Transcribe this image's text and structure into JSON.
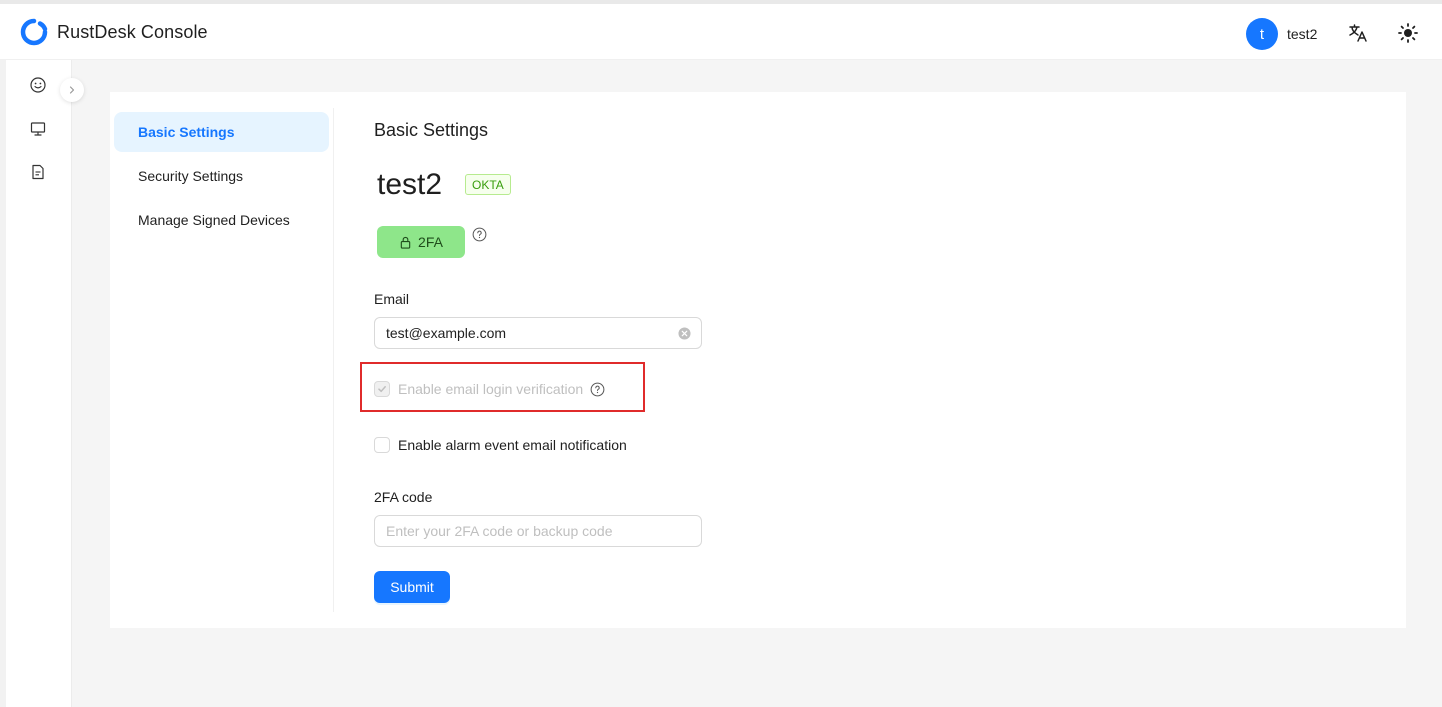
{
  "header": {
    "brand_name": "RustDesk Console",
    "logo_icon": "rustdesk-logo-icon",
    "user": {
      "avatar_letter": "t",
      "name": "test2"
    },
    "language_icon": "translate-icon",
    "theme_icon": "sun-icon"
  },
  "side_rail": {
    "items": [
      {
        "icon": "smiley-icon"
      },
      {
        "icon": "monitor-icon"
      },
      {
        "icon": "document-icon"
      }
    ],
    "collapse_icon": "chevron-right-icon"
  },
  "settings_nav": {
    "items": [
      {
        "label": "Basic Settings",
        "active": true
      },
      {
        "label": "Security Settings",
        "active": false
      },
      {
        "label": "Manage Signed Devices",
        "active": false
      }
    ]
  },
  "basic_settings": {
    "title": "Basic Settings",
    "username": "test2",
    "provider_tag": "OKTA",
    "twofa_button": "2FA",
    "email": {
      "label": "Email",
      "value": "test@example.com"
    },
    "email_login_verification": {
      "label": "Enable email login verification",
      "checked": true,
      "disabled": true
    },
    "alarm_notification": {
      "label": "Enable alarm event email notification",
      "checked": false
    },
    "twofa_code": {
      "label": "2FA code",
      "placeholder": "Enter your 2FA code or backup code",
      "value": ""
    },
    "submit_label": "Submit"
  },
  "colors": {
    "primary": "#1677ff",
    "twofa_green": "#8ee68a",
    "tag_green": "#389e0d",
    "highlight_red": "#e02b2b"
  }
}
